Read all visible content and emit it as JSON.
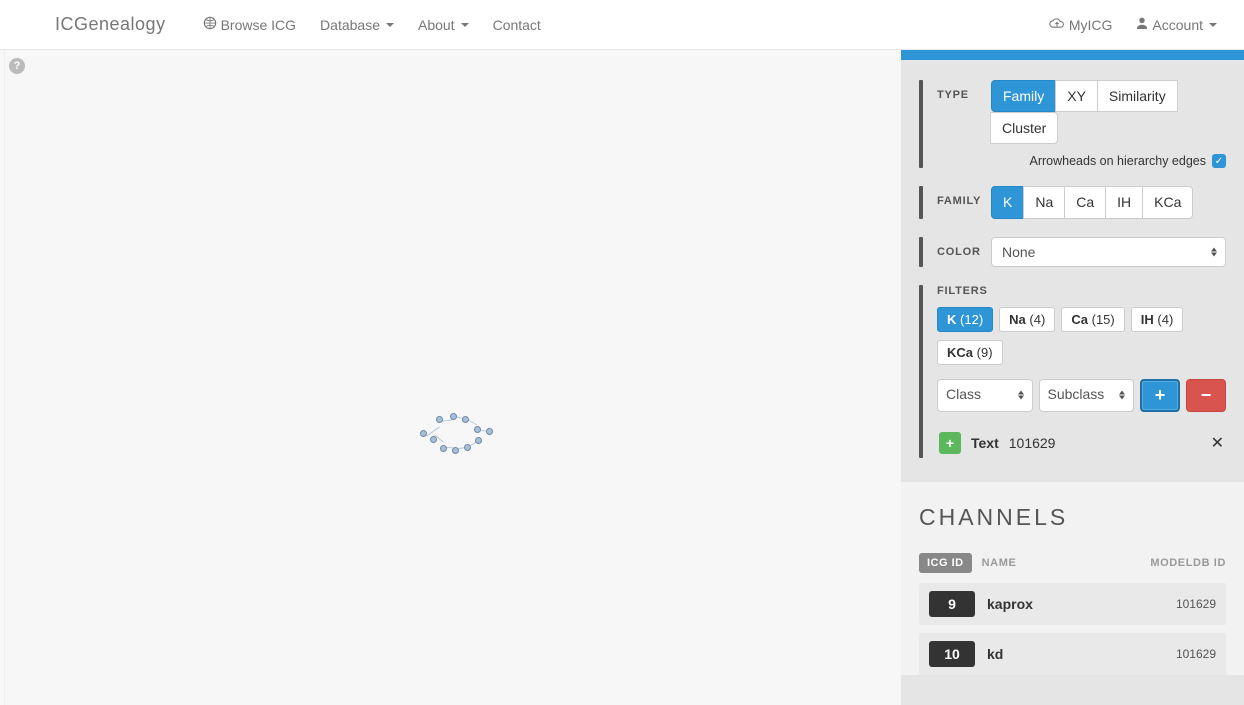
{
  "nav": {
    "brand": "ICGenealogy",
    "browse": "Browse ICG",
    "database": "Database",
    "about": "About",
    "contact": "Contact",
    "myicg": "MyICG",
    "account": "Account"
  },
  "help_badge": "?",
  "controls": {
    "type": {
      "label": "TYPE",
      "options": [
        "Family",
        "XY",
        "Similarity",
        "Cluster"
      ],
      "active": "Family",
      "arrowheads_label": "Arrowheads on hierarchy edges",
      "arrowheads_checked": true
    },
    "family": {
      "label": "FAMILY",
      "options": [
        "K",
        "Na",
        "Ca",
        "IH",
        "KCa"
      ],
      "active": "K"
    },
    "color": {
      "label": "COLOR",
      "value": "None"
    },
    "filters": {
      "label": "FILTERS",
      "chips": [
        {
          "label": "K",
          "count": 12,
          "active": true
        },
        {
          "label": "Na",
          "count": 4,
          "active": false
        },
        {
          "label": "Ca",
          "count": 15,
          "active": false
        },
        {
          "label": "IH",
          "count": 4,
          "active": false
        },
        {
          "label": "KCa",
          "count": 9,
          "active": false
        }
      ],
      "class_select": "Class",
      "subclass_select": "Subclass",
      "text_filter": {
        "label": "Text",
        "value": "101629"
      }
    }
  },
  "channels": {
    "title": "CHANNELS",
    "header": {
      "icgid": "ICG ID",
      "name": "NAME",
      "modeldb": "MODELDB ID"
    },
    "rows": [
      {
        "id": "9",
        "name": "kaprox",
        "modeldb": "101629"
      },
      {
        "id": "10",
        "name": "kd",
        "modeldb": "101629"
      }
    ]
  }
}
